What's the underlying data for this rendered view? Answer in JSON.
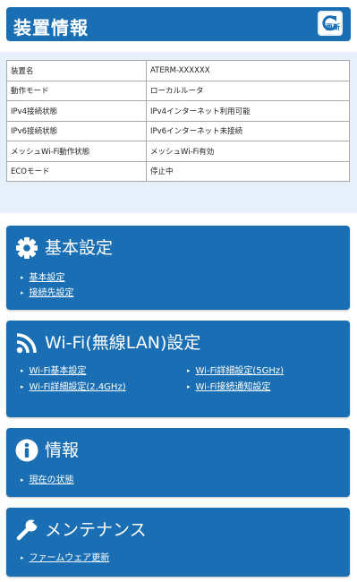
{
  "header": {
    "title": "装置情報",
    "refresh_label": "更新"
  },
  "device_info": [
    {
      "label": "装置名",
      "value": "ATERM-XXXXXX"
    },
    {
      "label": "動作モード",
      "value": "ローカルルータ"
    },
    {
      "label": "IPv4接続状態",
      "value": "IPv4インターネット利用可能"
    },
    {
      "label": "IPv6接続状態",
      "value": "IPv6インターネット未接続"
    },
    {
      "label": "メッシュWi-Fi動作状態",
      "value": "メッシュWi-Fi有効"
    },
    {
      "label": "ECOモード",
      "value": "停止中"
    }
  ],
  "basic": {
    "title": "基本設定",
    "links": [
      "基本設定",
      "接続先設定"
    ]
  },
  "wifi": {
    "title": "Wi-Fi(無線LAN)設定",
    "links": [
      "Wi-Fi基本設定",
      "Wi-Fi詳細設定(2.4GHz)",
      "Wi-Fi詳細設定(5GHz)",
      "Wi-Fi接続通知設定"
    ]
  },
  "info": {
    "title": "情報",
    "links": [
      "現在の状態"
    ]
  },
  "maint": {
    "title": "メンテナンス",
    "links": [
      "ファームウェア更新"
    ]
  },
  "colors": {
    "primary": "#1a6fb4",
    "band": "#e6f0fa"
  },
  "icons": {
    "basic": "gear-icon",
    "wifi": "wifi-icon",
    "info": "info-icon",
    "maint": "wrench-icon",
    "refresh": "refresh-icon"
  }
}
